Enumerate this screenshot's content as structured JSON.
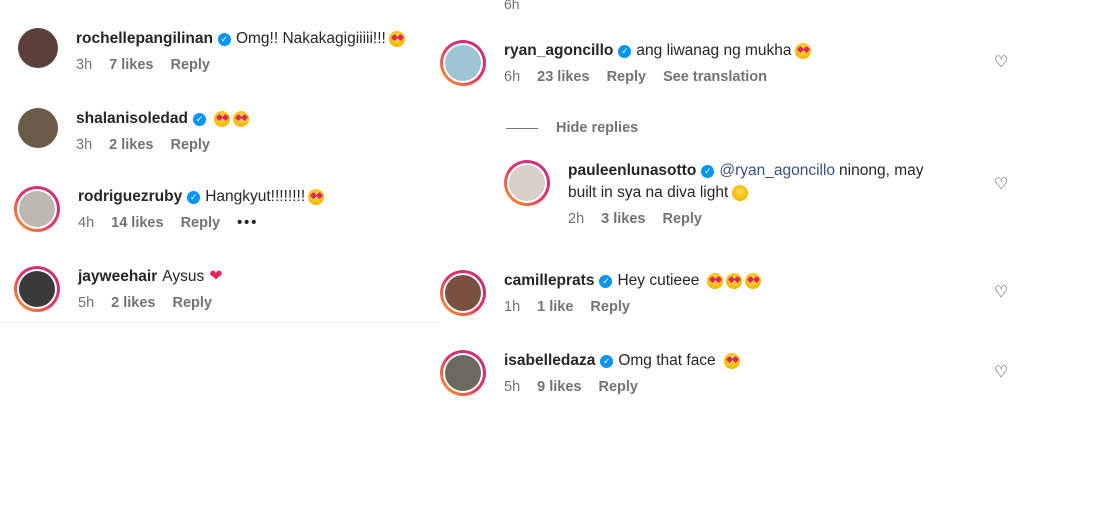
{
  "left": [
    {
      "user": "rochellepangilinan",
      "text": "Omg!! Nakakagigiiiii!!!",
      "emoji": "heart-eyes",
      "time": "3h",
      "likes": "7 likes",
      "reply": "Reply",
      "avatar": "#5a4038"
    },
    {
      "user": "shalanisoledad",
      "text": "",
      "emoji": "heart-eyes-x2",
      "time": "3h",
      "likes": "2 likes",
      "reply": "Reply",
      "avatar": "#6b5a48"
    },
    {
      "user": "rodriguezruby",
      "text": "Hangkyut!!!!!!!!",
      "emoji": "heart-eyes",
      "time": "4h",
      "likes": "14 likes",
      "reply": "Reply",
      "more": "•••",
      "avatar": "#bcb8b0"
    },
    {
      "user": "jayweehair",
      "text": "Aysus",
      "emoji": "red-heart",
      "time": "5h",
      "likes": "2 likes",
      "reply": "Reply",
      "avatar": "#3a3a3a"
    }
  ],
  "right": {
    "top_time": "6h",
    "ryan": {
      "user": "ryan_agoncillo",
      "text": "ang liwanag ng mukha",
      "emoji": "heart-eyes",
      "time": "6h",
      "likes": "23 likes",
      "reply": "Reply",
      "translate": "See translation",
      "avatar": "#9ec5d6"
    },
    "hide_replies": "Hide replies",
    "pauleen": {
      "user": "pauleenlunasotto",
      "mention": "@ryan_agoncillo",
      "text": "ninong, may",
      "text2": "built in sya na diva light",
      "emoji": "laughing",
      "time": "2h",
      "likes": "3 likes",
      "reply": "Reply",
      "avatar": "#d8cfc8"
    },
    "camille": {
      "user": "camilleprats",
      "text": "Hey cutieee",
      "emoji": "heart-eyes-x3",
      "time": "1h",
      "likes": "1 like",
      "reply": "Reply",
      "avatar": "#7a5040"
    },
    "isabelle": {
      "user": "isabelledaza",
      "text": "Omg that face",
      "emoji": "heart-eyes",
      "time": "5h",
      "likes": "9 likes",
      "reply": "Reply",
      "avatar": "#6a6a60"
    }
  },
  "icons": {
    "verified": "verified-badge-icon",
    "like": "heart-outline-icon"
  },
  "colors": {
    "verified": "#0095f6",
    "meta": "#737373",
    "text": "#262626",
    "mention": "#385185"
  }
}
